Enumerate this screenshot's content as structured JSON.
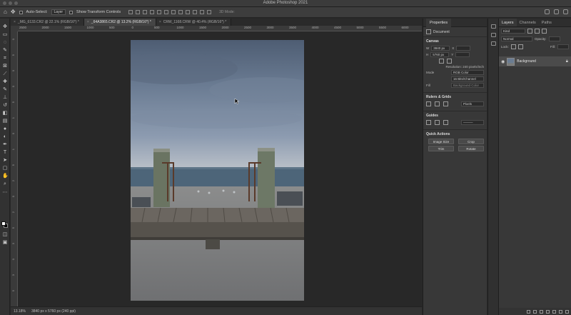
{
  "app": {
    "title": "Adobe Photoshop 2021"
  },
  "options_bar": {
    "auto_select_label": "Auto-Select:",
    "auto_select_target": "Layer",
    "transform_label": "Show Transform Controls",
    "mode_3d_label": "3D Mode:"
  },
  "tabs": [
    {
      "label": "_MG_6133.CR2 @ 22.1% (RGB/16*) *",
      "active": false
    },
    {
      "label": "_64A3865.CR2 @ 13.2% (RGB/16*) *",
      "active": true
    },
    {
      "label": "CRW_1168.CRW @ 40.4% (RGB/16*) *",
      "active": false
    }
  ],
  "ruler_h": [
    "2500",
    "2000",
    "1500",
    "1000",
    "500",
    "0",
    "500",
    "1000",
    "1500",
    "2000",
    "2500",
    "3000",
    "3500",
    "4000",
    "4500",
    "5000",
    "5500",
    "6000"
  ],
  "ruler_v": [
    "0",
    "5",
    "0",
    "0",
    "5",
    "1",
    "0",
    "1",
    "5",
    "2",
    "0",
    "2",
    "5",
    "3",
    "0",
    "3",
    "5"
  ],
  "status": {
    "zoom": "13.18%",
    "doc_info": "3840 px x 5760 px (240 ppi)"
  },
  "properties": {
    "tab_label": "Properties",
    "doc_label": "Document",
    "canvas_head": "Canvas",
    "width_label": "W",
    "width_value": "3840 px",
    "height_label": "H",
    "height_value": "5760 px",
    "x_label": "X",
    "y_label": "Y",
    "resolution": "Resolution: 240 pixels/inch",
    "mode_label": "Mode",
    "mode_value": "RGB Color",
    "bits_value": "16 Bits/Channel",
    "fill_label": "Fill",
    "fill_value": "Background Color",
    "rulers_head": "Rulers & Grids",
    "units_value": "Pixels",
    "guides_head": "Guides",
    "quick_head": "Quick Actions",
    "btn_image_size": "Image Size",
    "btn_crop": "Crop",
    "btn_trim": "Trim",
    "btn_rotate": "Rotate"
  },
  "layers_panel": {
    "tabs": [
      "Layers",
      "Channels",
      "Paths"
    ],
    "kind_label": "Kind",
    "blend_mode": "Normal",
    "opacity_label": "Opacity:",
    "lock_label": "Lock:",
    "fill_label": "Fill:",
    "layer_name": "Background"
  },
  "colors": {
    "foreground": "#ffffff",
    "background": "#000000",
    "sky": "#6f7f93",
    "sea": "#4d6579",
    "sand": "#8a8a86",
    "boardwalk": "#56524c"
  }
}
